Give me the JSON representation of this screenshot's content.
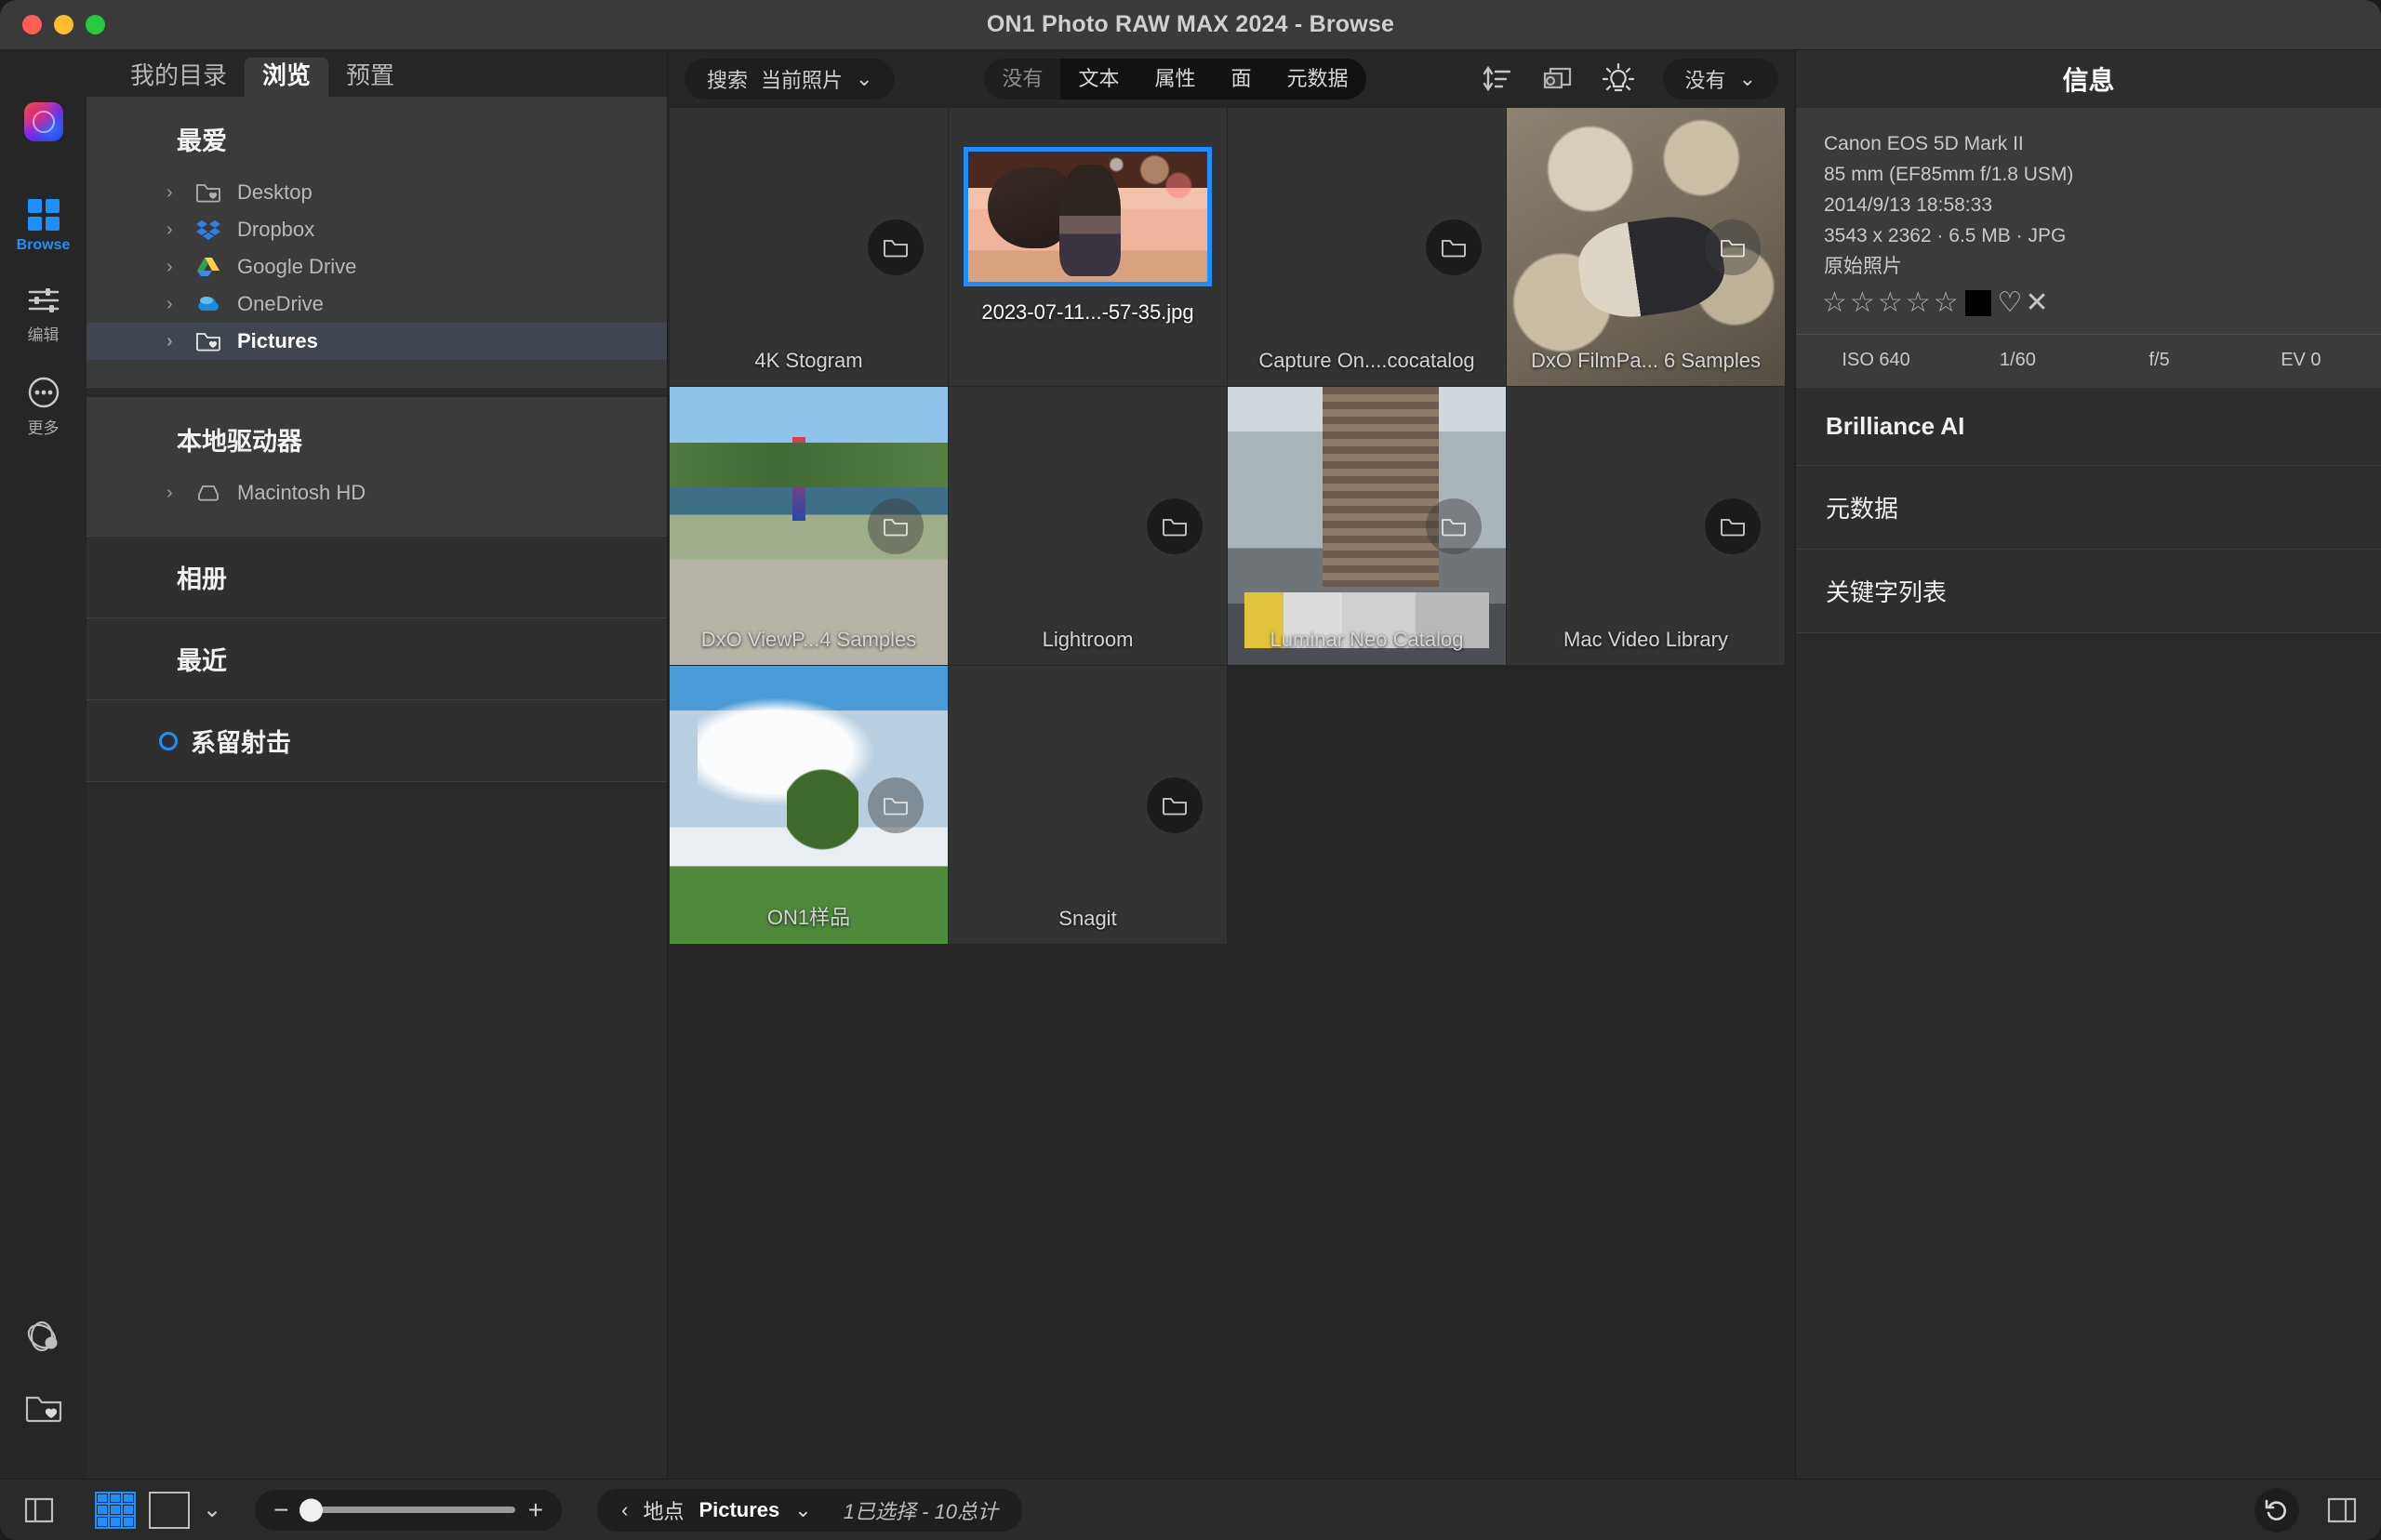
{
  "window": {
    "title": "ON1 Photo RAW MAX 2024 - Browse",
    "controls": {
      "close": "close-button",
      "minimize": "minimize-button",
      "zoom": "zoom-button"
    }
  },
  "rail": {
    "items": [
      {
        "label": "Browse",
        "icon": "grid-icon",
        "active": true
      },
      {
        "label": "编辑",
        "icon": "sliders-icon",
        "active": false
      },
      {
        "label": "更多",
        "icon": "ellipsis-icon",
        "active": false
      }
    ],
    "bottom": [
      {
        "icon": "atom-icon",
        "name": "sync-icon"
      },
      {
        "icon": "folder-heart-icon",
        "name": "favorite-folder-icon"
      }
    ]
  },
  "tabs": [
    {
      "label": "我的目录",
      "active": false
    },
    {
      "label": "浏览",
      "active": true
    },
    {
      "label": "预置",
      "active": false
    }
  ],
  "sidebar": {
    "favorites": {
      "title": "最爱",
      "items": [
        {
          "label": "Desktop",
          "icon": "folder-heart-icon",
          "selected": false
        },
        {
          "label": "Dropbox",
          "icon": "dropbox-icon",
          "selected": false
        },
        {
          "label": "Google Drive",
          "icon": "google-drive-icon",
          "selected": false
        },
        {
          "label": "OneDrive",
          "icon": "onedrive-icon",
          "selected": false
        },
        {
          "label": "Pictures",
          "icon": "folder-heart-icon",
          "selected": true
        }
      ]
    },
    "local_drives": {
      "title": "本地驱动器",
      "items": [
        {
          "label": "Macintosh HD",
          "icon": "hard-drive-icon",
          "selected": false
        }
      ]
    },
    "sections": [
      {
        "label": "相册",
        "dot": false
      },
      {
        "label": "最近",
        "dot": false
      },
      {
        "label": "系留射击",
        "dot": true
      }
    ]
  },
  "toolbar": {
    "search": {
      "label": "搜索",
      "value": "当前照片",
      "chevron": "chevron-down-icon"
    },
    "filters": [
      {
        "label": "没有",
        "state": "off"
      },
      {
        "label": "文本",
        "state": "selected"
      },
      {
        "label": "属性",
        "state": "on"
      },
      {
        "label": "面",
        "state": "on"
      },
      {
        "label": "元数据",
        "state": "on"
      }
    ],
    "icons": [
      {
        "name": "sort-icon"
      },
      {
        "name": "slideshow-settings-icon"
      },
      {
        "name": "lightbulb-icon"
      }
    ],
    "view_dropdown": {
      "label": "没有",
      "chevron": "chevron-down-icon"
    }
  },
  "grid": {
    "items": [
      {
        "caption": "4K Stogram",
        "kind": "folder",
        "art": null,
        "selected": false
      },
      {
        "caption": "2023-07-11...-57-35.jpg",
        "kind": "photo-selected",
        "art": "art-anime",
        "selected": true
      },
      {
        "caption": "Capture On....cocatalog",
        "kind": "folder",
        "art": null,
        "selected": false
      },
      {
        "caption": "DxO FilmPa... 6 Samples",
        "kind": "folder-photo",
        "art": "art-mosaic",
        "selected": false
      },
      {
        "caption": "DxO ViewP...4 Samples",
        "kind": "folder-photo",
        "art": "art-river",
        "selected": false
      },
      {
        "caption": "Lightroom",
        "kind": "folder",
        "art": null,
        "selected": false
      },
      {
        "caption": "Luminar Neo Catalog",
        "kind": "folder-photo",
        "art": "art-city",
        "selected": false
      },
      {
        "caption": "Mac Video Library",
        "kind": "folder",
        "art": null,
        "selected": false
      },
      {
        "caption": "ON1样品",
        "kind": "folder-photo",
        "art": "art-tree",
        "selected": false
      },
      {
        "caption": "Snagit",
        "kind": "folder",
        "art": null,
        "selected": false
      }
    ]
  },
  "info_panel": {
    "title": "信息",
    "camera": "Canon EOS 5D Mark II",
    "lens": "85 mm (EF85mm f/1.8 USM)",
    "datetime": "2014/9/13  18:58:33",
    "file": "3543 x 2362 · 6.5 MB · JPG",
    "source": "原始照片",
    "rating": {
      "stars": 5,
      "filled": 0,
      "color_chip": "#000000",
      "heart": "♡",
      "reject": "✕"
    },
    "exif": [
      {
        "label": "ISO 640"
      },
      {
        "label": "1/60"
      },
      {
        "label": "f/5"
      },
      {
        "label": "EV 0"
      }
    ],
    "sections": [
      {
        "label": "Brilliance AI",
        "bold": true
      },
      {
        "label": "元数据",
        "bold": false
      },
      {
        "label": "关键字列表",
        "bold": false
      }
    ]
  },
  "bottom_bar": {
    "left_panel_toggle": "panel-left-icon",
    "view_grid": "grid-view-icon",
    "view_single": "single-view-icon",
    "view_chevron": "chevron-down-icon",
    "zoom": {
      "minus": "−",
      "plus": "+",
      "value": 8
    },
    "location": {
      "back": "‹",
      "label": "地点",
      "value": "Pictures",
      "chevron": "chevron-down-icon"
    },
    "selection_status": "1已选择 - 10总计",
    "revert": "revert-icon",
    "right_panel_toggle": "panel-right-icon"
  },
  "colors": {
    "accent": "#1e8fff",
    "panel": "#3b3b3b",
    "background": "#2a2a2a",
    "selection": "#3f4650"
  }
}
